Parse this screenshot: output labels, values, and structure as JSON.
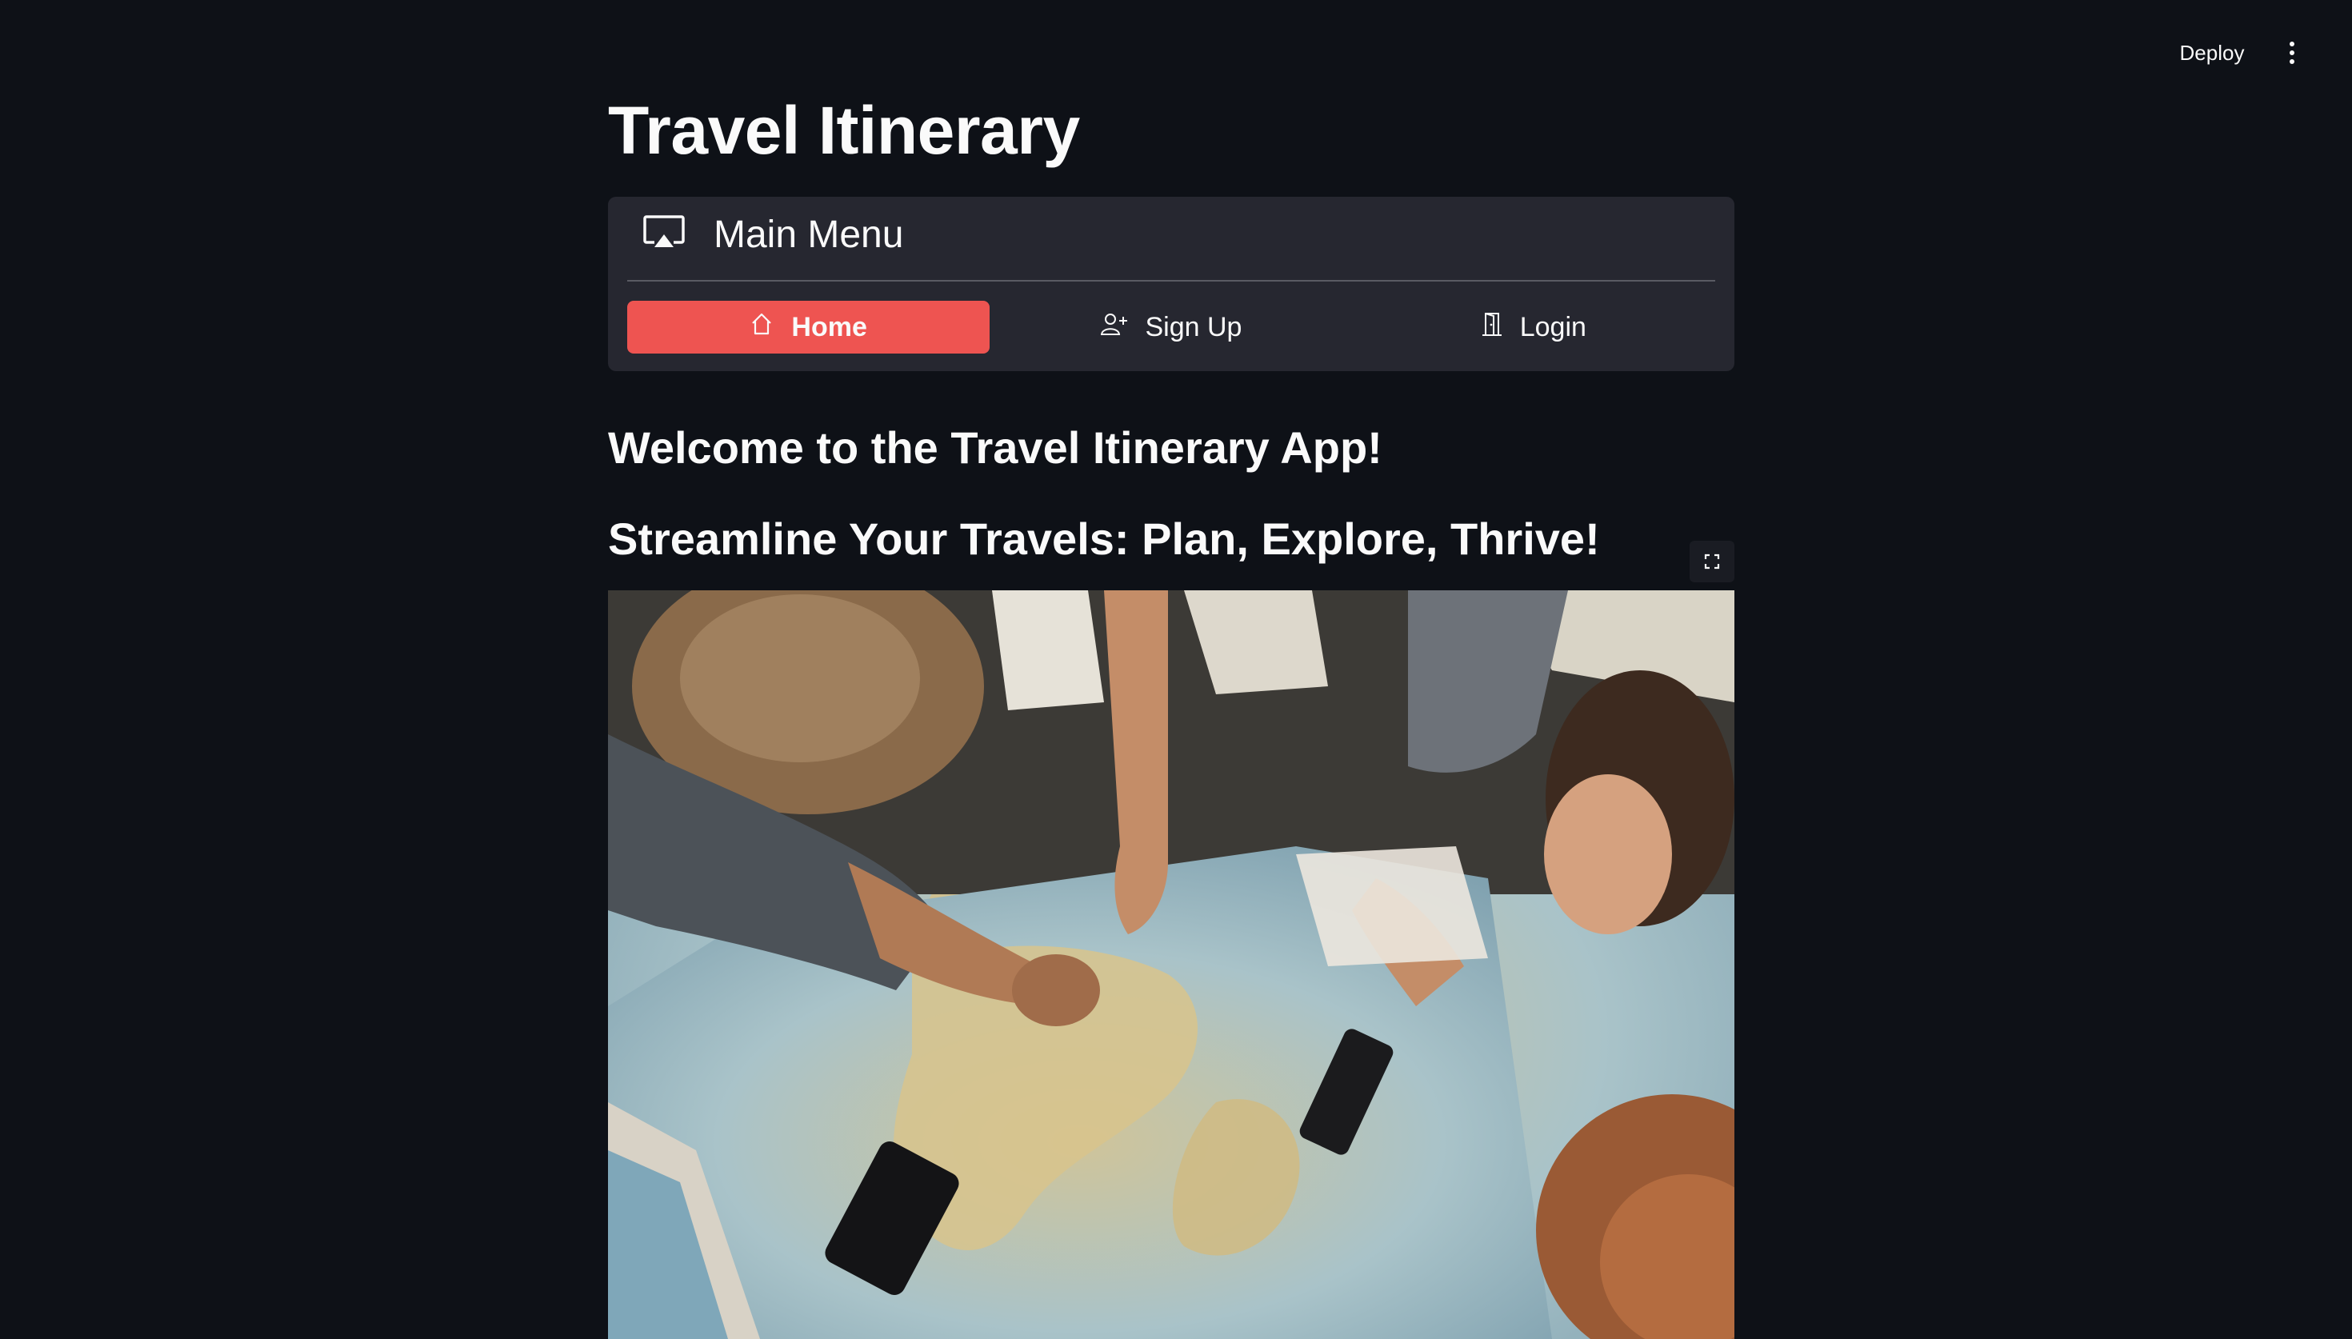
{
  "header": {
    "deploy_label": "Deploy",
    "menu_icon": "kebab-menu-icon"
  },
  "page": {
    "title": "Travel Itinerary"
  },
  "main_menu": {
    "icon": "cast-icon",
    "title": "Main Menu",
    "items": [
      {
        "label": "Home",
        "icon": "house-icon",
        "active": true
      },
      {
        "label": "Sign Up",
        "icon": "person-plus-icon",
        "active": false
      },
      {
        "label": "Login",
        "icon": "door-icon",
        "active": false
      }
    ]
  },
  "content": {
    "welcome_heading": "Welcome to the Travel Itinerary App!",
    "tagline_heading": "Streamline Your Travels: Plan, Explore, Thrive!",
    "fullscreen_icon": "fullscreen-icon"
  },
  "colors": {
    "background": "#0e1117",
    "card": "#262730",
    "accent": "#ee5451",
    "text": "#fafafa"
  }
}
